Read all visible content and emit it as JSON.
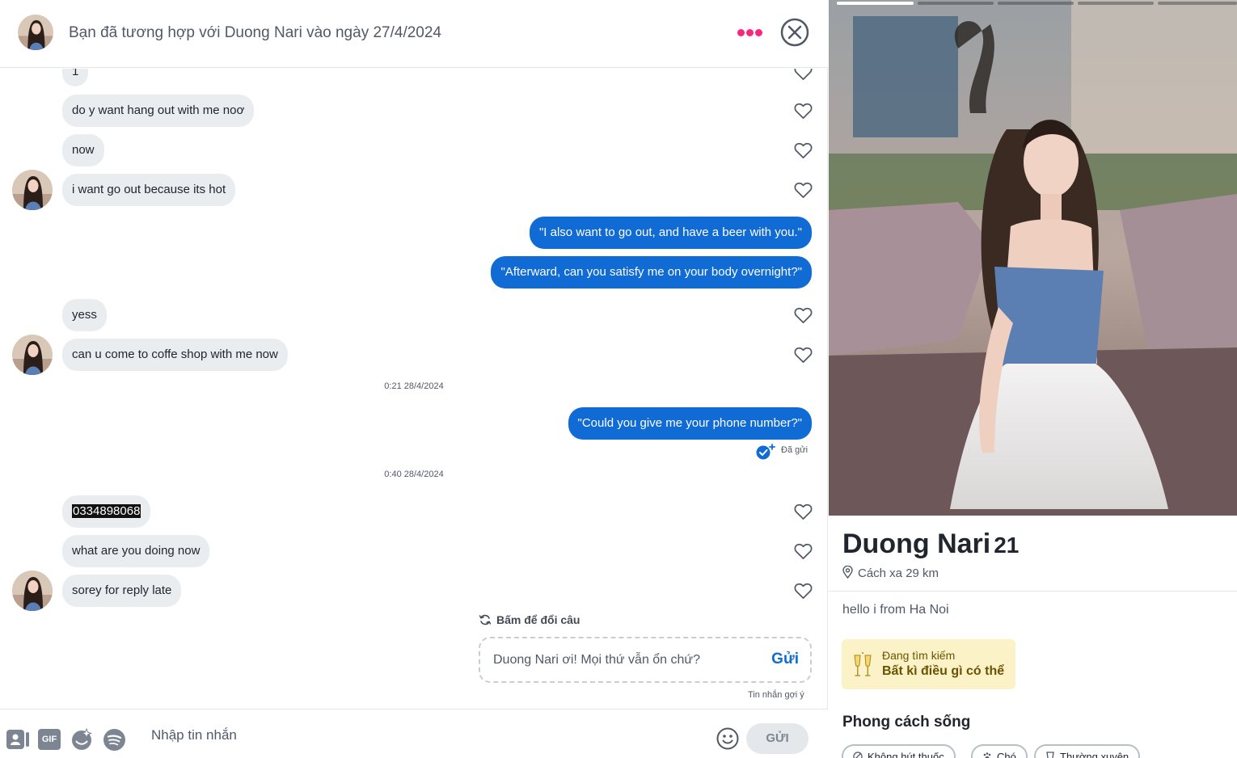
{
  "header": {
    "title": "Bạn đã tương hợp với Duong Nari vào ngày 27/4/2024"
  },
  "messages": [
    {
      "text": "1",
      "dir": "in"
    },
    {
      "text": "do y want hang out with me noơ",
      "dir": "in"
    },
    {
      "text": "now",
      "dir": "in"
    },
    {
      "text": "i want go out because its hot",
      "dir": "in"
    },
    {
      "text": "\"I also want to go out, and have a beer with you.\"",
      "dir": "out"
    },
    {
      "text": "\"Afterward, can you satisfy me on your body overnight?\"",
      "dir": "out"
    },
    {
      "text": "yess",
      "dir": "in"
    },
    {
      "text": "can u come to coffe shop with me now",
      "dir": "in"
    },
    {
      "text": "\"Could you give me your phone number?\"",
      "dir": "out"
    },
    {
      "text": "0334898068",
      "dir": "in"
    },
    {
      "text": "what are you doing now",
      "dir": "in"
    },
    {
      "text": "sorey for reply late",
      "dir": "in"
    }
  ],
  "timestamps": [
    "0:21 28/4/2024",
    "0:40 28/4/2024"
  ],
  "sent_status": "Đã gửi",
  "suggestion": {
    "label": "Bấm để đổi câu",
    "text": "Duong Nari ơi! Mọi thứ vẫn ổn chứ?",
    "send": "Gửi",
    "caption": "Tin nhắn gợi ý"
  },
  "composer": {
    "gif_label": "GIF",
    "placeholder": "Nhập tin nhắn",
    "send": "GỬI"
  },
  "profile": {
    "name": "Duong Nari",
    "age": "21",
    "distance": "Cách xa 29 km",
    "bio": "hello i from Ha Noi",
    "looking_for_label": "Đang tìm kiếm",
    "looking_for_value": "Bất kì điều gì có thể",
    "lifestyle_title": "Phong cách sống",
    "lifestyle_chips": [
      "Không hút thuốc",
      "Chó",
      "Thường xuyên"
    ],
    "photo_count": 5,
    "active_photo": 1
  },
  "colors": {
    "accent_blue": "#106bd5",
    "brand_pink": "#fd267d",
    "incoming_bubble": "#eaedf0",
    "looking_bg": "#fbf3c7"
  }
}
